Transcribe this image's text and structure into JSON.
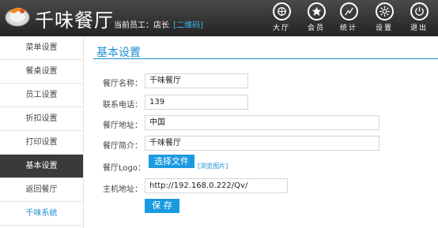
{
  "header": {
    "logo_text": "千味餐厅",
    "staff_label": "当前员工：店长",
    "qr_link": "[二维码]",
    "nav": [
      {
        "label": "大厅",
        "icon": "hall-icon"
      },
      {
        "label": "会员",
        "icon": "member-icon"
      },
      {
        "label": "统计",
        "icon": "stats-icon"
      },
      {
        "label": "设置",
        "icon": "settings-icon"
      },
      {
        "label": "退出",
        "icon": "logout-icon"
      }
    ]
  },
  "sidebar": {
    "items": [
      {
        "label": "菜单设置"
      },
      {
        "label": "餐桌设置"
      },
      {
        "label": "员工设置"
      },
      {
        "label": "折扣设置"
      },
      {
        "label": "打印设置"
      },
      {
        "label": "基本设置",
        "active": true
      },
      {
        "label": "返回餐厅"
      },
      {
        "label": "千味系统"
      }
    ]
  },
  "main": {
    "title": "基本设置",
    "form": {
      "name_label": "餐厅名称：",
      "name_value": "千味餐厅",
      "phone_label": "联系电话：",
      "phone_value": "139",
      "address_label": "餐厅地址：",
      "address_value": "中国",
      "intro_label": "餐厅简介：",
      "intro_value": "千味餐厅",
      "logo_label": "餐厅Logo：",
      "choose_file": "选择文件",
      "browse_image": "[浏览图片]",
      "host_label": "主机地址：",
      "host_value": "http://192.168.0.222/Qv/",
      "save": "保 存"
    }
  },
  "colors": {
    "accent": "#1b8fd2",
    "button": "#1a9ae0",
    "header": "#2e2e2e",
    "active_item": "#3a3a3a"
  }
}
